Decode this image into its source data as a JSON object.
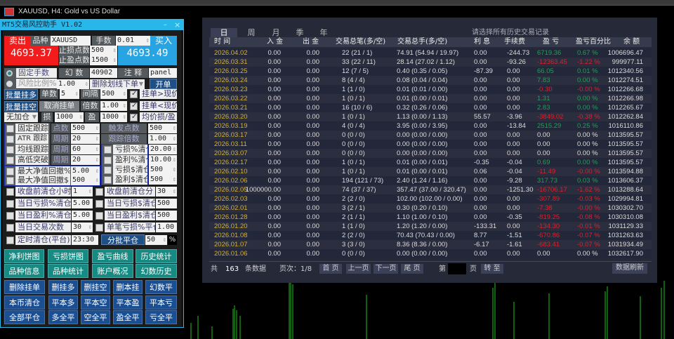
{
  "chart": {
    "title": "XAUUSD, H4:  Gold vs US Dollar"
  },
  "panel": {
    "title": "MT5交易风控助手 V1.02",
    "minimize": "–",
    "close": "×",
    "sell_label": "卖出",
    "sell_price": "4693.37",
    "buy_label": "买入",
    "buy_price": "4693.49",
    "symbol_label": "品种",
    "symbol": "XAUUSD",
    "lots_label": "手数",
    "lots": "0.01",
    "sl_label": "止损点数",
    "sl": "500",
    "tp_label": "止盈点数",
    "tp": "1500",
    "fixed_lots": "固定手数",
    "risk_ratio": "风险比例%",
    "risk_value": "1.00",
    "magic_label": "幻 数",
    "magic": "40902",
    "comment_label": "注 释",
    "comment": "panel",
    "order_mode": "删除划线下单",
    "open_btn": "开单",
    "batch_buy": "批量挂多",
    "count_label": "单数",
    "count": "5",
    "gap_label": "间隔",
    "gap": "500",
    "pend_above": "挂单>现价",
    "batch_sell": "批量挂空",
    "cancel_pending": "取消挂单",
    "mult_label": "倍数",
    "mult": "1.00",
    "pend_below": "挂单<现价",
    "add_mode": "无加仓",
    "loss_label": "损",
    "loss": "1000",
    "profit_label": "盈",
    "profit": "1000",
    "avg_sltp": "均价损/盈",
    "trail": [
      {
        "name": "固定跟踪",
        "plabel": "点数",
        "pval": "500",
        "rlabel": "触发点数",
        "rval": "500"
      },
      {
        "name": "ATR 跟踪",
        "plabel": "周期",
        "pval": "20",
        "rlabel": "跟踪倍数",
        "rval": "1.00"
      },
      {
        "name": "均线跟踪",
        "plabel": "周期",
        "pval": "60"
      },
      {
        "name": "高低突破",
        "plabel": "周期",
        "pval": "20"
      }
    ],
    "closeout": [
      {
        "name": "亏损%清仓",
        "val": "20.00"
      },
      {
        "name": "盈利%清仓",
        "val": "10.00"
      },
      {
        "name": "亏损$清仓",
        "val": "500"
      },
      {
        "name": "盈利$清仓",
        "val": "500"
      }
    ],
    "drawdown": [
      {
        "name": "最大净值回撤%",
        "val": "5.00"
      },
      {
        "name": "最大净值回撤$",
        "val": "500"
      }
    ],
    "rules": [
      {
        "l": "收盘前清仓小时",
        "lv": "1",
        "r": "收盘前清仓分",
        "rv": "30"
      },
      {
        "l": "当日亏损%清仓",
        "lv": "5.00",
        "r": "当日亏损$清仓",
        "rv": "500"
      },
      {
        "l": "当日盈利%清仓",
        "lv": "5.00",
        "r": "当日盈利$清仓",
        "rv": "500"
      },
      {
        "l": "当日交易次数",
        "lv": "30",
        "r": "单笔亏损%平仓",
        "rv": "1.00"
      }
    ],
    "timed_close": "定时清仓(平台)",
    "timed_value": "23:30",
    "partial_close": "分批平仓",
    "partial_value": "50",
    "percent": "%",
    "teal_buttons": [
      "净利饼图",
      "亏损饼图",
      "盈亏曲线",
      "历史统计",
      "品种信息",
      "品种统计",
      "账户概况",
      "幻数历史"
    ],
    "blue_buttons": [
      "删除挂单",
      "删挂多",
      "删挂空",
      "删本挂",
      "幻数平",
      "本币清仓",
      "平本多",
      "平本空",
      "平本盈",
      "平本亏",
      "全部平仓",
      "多全平",
      "空全平",
      "盈全平",
      "亏全平"
    ]
  },
  "report": {
    "tabs": [
      "日",
      "周",
      "月",
      "季",
      "年"
    ],
    "hint": "请选择所有历史交易记录",
    "headers": [
      "时 间",
      "入 金",
      "出 金",
      "交易总笔(多/空)",
      "交易总手(多/空)",
      "利 息",
      "手续费",
      "盈 亏",
      "盈亏百分比",
      "余 额"
    ],
    "rows": [
      [
        "2026.04.02",
        "0.00",
        "0.00",
        "22  (21 / 1)",
        "74.91  (54.94 / 19.97)",
        "0.00",
        "-244.73",
        "6719.36",
        "0.67 %",
        "1006696.47"
      ],
      [
        "2026.03.31",
        "0.00",
        "0.00",
        "33  (22 / 11)",
        "28.14  (27.02 / 1.12)",
        "0.00",
        "-93.26",
        "-12363.45",
        "-1.22 %",
        "999977.11"
      ],
      [
        "2026.03.25",
        "0.00",
        "0.00",
        "12  (7 / 5)",
        "0.40  (0.35 / 0.05)",
        "-87.39",
        "0.00",
        "66.05",
        "0.01 %",
        "1012340.56"
      ],
      [
        "2026.03.24",
        "0.00",
        "0.00",
        "8  (4 / 4)",
        "0.08  (0.04 / 0.04)",
        "0.00",
        "0.00",
        "7.83",
        "0.00 %",
        "1012274.51"
      ],
      [
        "2026.03.23",
        "0.00",
        "0.00",
        "1  (1 / 0)",
        "0.01  (0.01 / 0.00)",
        "0.00",
        "0.00",
        "-0.30",
        "-0.00 %",
        "1012266.68"
      ],
      [
        "2026.03.22",
        "0.00",
        "0.00",
        "1  (0 / 1)",
        "0.01  (0.00 / 0.01)",
        "0.00",
        "0.00",
        "1.31",
        "0.00 %",
        "1012266.98"
      ],
      [
        "2026.03.21",
        "0.00",
        "0.00",
        "16  (10 / 6)",
        "0.32  (0.26 / 0.06)",
        "0.00",
        "0.00",
        "2.83",
        "0.00 %",
        "1012265.67"
      ],
      [
        "2026.03.20",
        "0.00",
        "0.00",
        "1  (0 / 1)",
        "1.13  (0.00 / 1.13)",
        "55.57",
        "-3.96",
        "-3849.02",
        "-0.38 %",
        "1012262.84"
      ],
      [
        "2026.03.19",
        "0.00",
        "0.00",
        "4  (0 / 4)",
        "3.95  (0.00 / 3.95)",
        "0.00",
        "-13.84",
        "2515.29",
        "0.25 %",
        "1016110.86"
      ],
      [
        "2026.03.17",
        "0.00",
        "0.00",
        "0  (0 / 0)",
        "0.00  (0.00 / 0.00)",
        "0.00",
        "0.00",
        "0.00",
        "0.00 %",
        "1013595.57"
      ],
      [
        "2026.03.11",
        "0.00",
        "0.00",
        "0  (0 / 0)",
        "0.00  (0.00 / 0.00)",
        "0.00",
        "0.00",
        "0.00",
        "0.00 %",
        "1013595.57"
      ],
      [
        "2026.03.07",
        "0.00",
        "0.00",
        "0  (0 / 0)",
        "0.00  (0.00 / 0.00)",
        "0.00",
        "0.00",
        "0.00",
        "0.00 %",
        "1013595.57"
      ],
      [
        "2026.02.17",
        "0.00",
        "0.00",
        "1  (0 / 1)",
        "0.01  (0.00 / 0.01)",
        "-0.35",
        "-0.04",
        "0.69",
        "0.00 %",
        "1013595.57"
      ],
      [
        "2026.02.10",
        "0.00",
        "0.00",
        "1  (0 / 1)",
        "0.01  (0.00 / 0.01)",
        "0.06",
        "-0.04",
        "-11.49",
        "-0.00 %",
        "1013594.88"
      ],
      [
        "2026.02.06",
        "0.00",
        "0.00",
        "194  (121 / 73)",
        "2.40  (1.24 / 1.16)",
        "0.00",
        "-9.28",
        "317.73",
        "0.03 %",
        "1013606.37"
      ],
      [
        "2026.02.05",
        "1000000.00",
        "0.00",
        "74  (37 / 37)",
        "357.47  (37.00 / 320.47)",
        "0.00",
        "-1251.30",
        "-16706.17",
        "-1.62 %",
        "1013288.64"
      ],
      [
        "2026.02.03",
        "0.00",
        "0.00",
        "2  (2 / 0)",
        "102.00  (102.00 / 0.00)",
        "0.00",
        "0.00",
        "-307.89",
        "-0.03 %",
        "1029994.81"
      ],
      [
        "2026.02.01",
        "0.00",
        "0.00",
        "3  (2 / 1)",
        "0.30  (0.20 / 0.10)",
        "0.00",
        "0.00",
        "-7.38",
        "-0.00 %",
        "1030302.70"
      ],
      [
        "2026.01.28",
        "0.00",
        "0.00",
        "2  (1 / 1)",
        "1.10  (1.00 / 0.10)",
        "0.00",
        "-0.35",
        "-819.25",
        "-0.08 %",
        "1030310.08"
      ],
      [
        "2026.01.20",
        "0.00",
        "0.00",
        "1  (1 / 0)",
        "1.20  (1.20 / 0.00)",
        "-133.31",
        "0.00",
        "-134.30",
        "-0.01 %",
        "1031129.33"
      ],
      [
        "2026.01.08",
        "0.00",
        "0.00",
        "2  (2 / 0)",
        "70.43  (70.43 / 0.00)",
        "8.77",
        "-1.51",
        "-670.86",
        "-0.07 %",
        "1031263.63"
      ],
      [
        "2026.01.07",
        "0.00",
        "0.00",
        "3  (3 / 0)",
        "8.36  (8.36 / 0.00)",
        "-6.17",
        "-1.61",
        "-683.41",
        "-0.07 %",
        "1031934.49"
      ],
      [
        "2026.01.06",
        "0.00",
        "0.00",
        "0  (0 / 0)",
        "0.00  (0.00 / 0.00)",
        "0.00",
        "0.00",
        "0.00",
        "0.00 %",
        "1032617.90"
      ]
    ],
    "footer": {
      "total_prefix": "共",
      "total": "163",
      "total_suffix": "条数据",
      "page": "页次：1/8",
      "first": "首 页",
      "prev": "上一页",
      "next": "下一页",
      "last": "尾 页",
      "page_prefix": "第",
      "page_suffix": "页",
      "goto": "转 至",
      "refresh": "数据刷新"
    }
  },
  "colors": {
    "profit": "#2a9a5a",
    "loss": "#e0202a",
    "date": "#d4b040"
  }
}
